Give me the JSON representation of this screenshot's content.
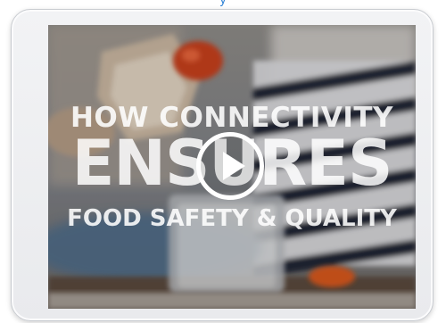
{
  "top_link": {
    "label": "y"
  },
  "video": {
    "title_line1": "HOW CONNECTIVITY",
    "title_line2": "ENSURES",
    "title_line3": "FOOD SAFETY & QUALITY",
    "play_icon": "play-icon"
  },
  "colors": {
    "tablet_frame": "#eceef0",
    "play_ring": "#ffffff",
    "link_blue": "#2a7fd4"
  }
}
